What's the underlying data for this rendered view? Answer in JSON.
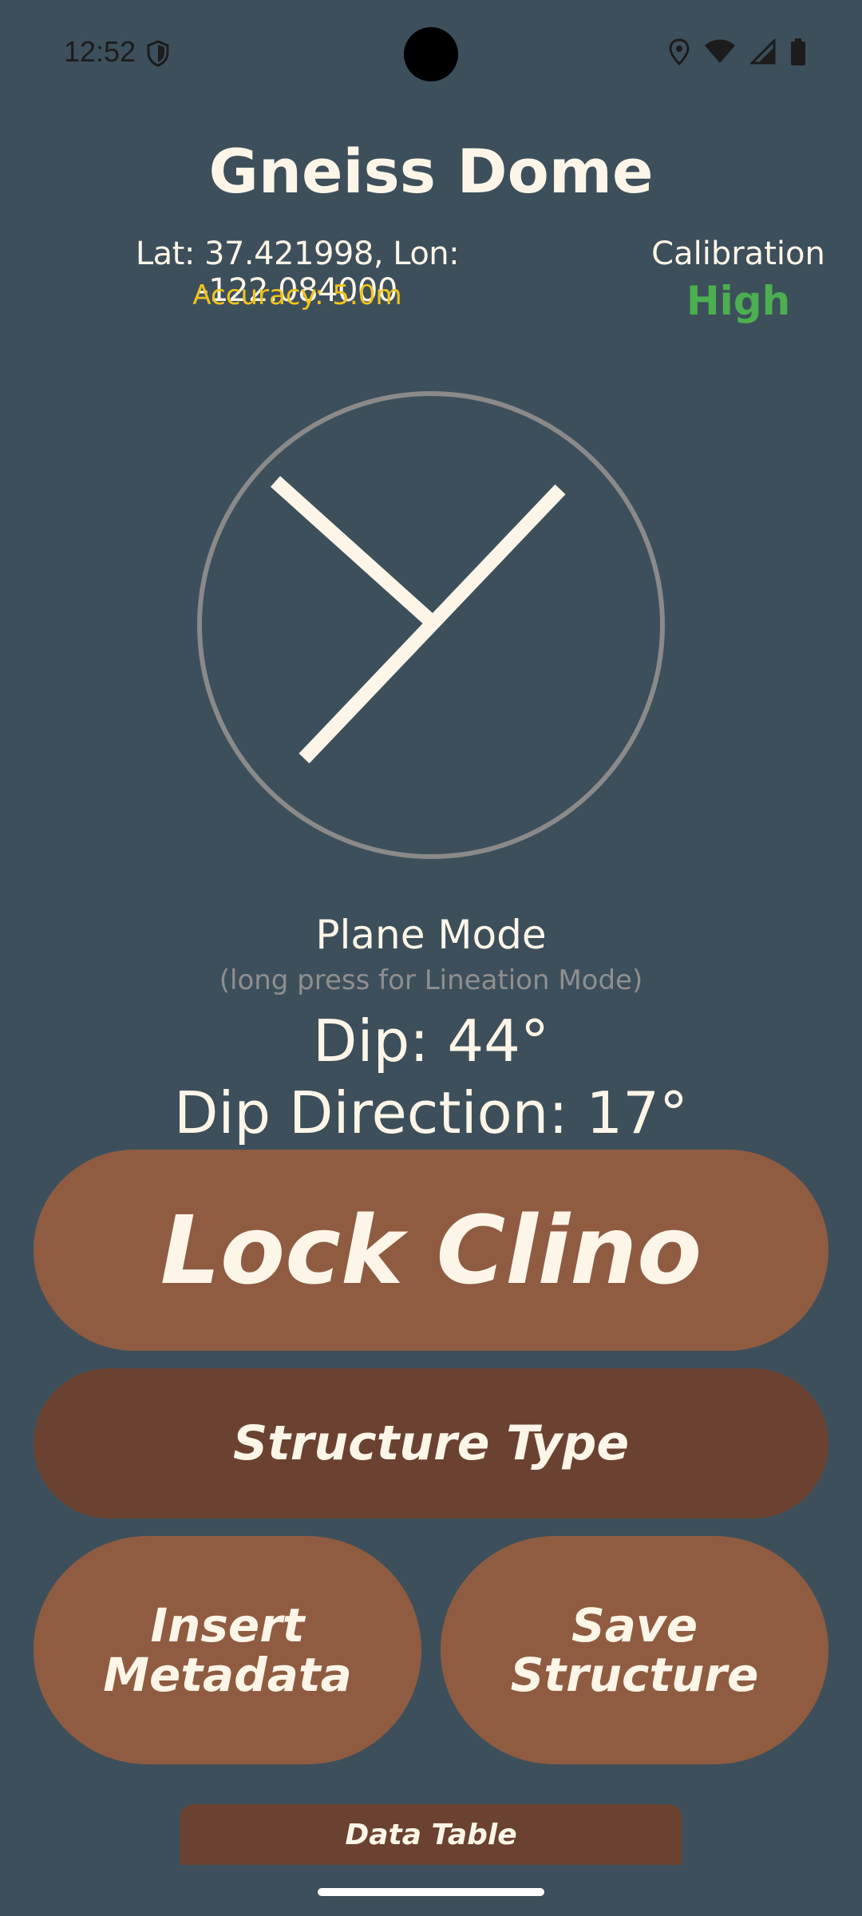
{
  "status_bar": {
    "time": "12:52",
    "icons": [
      "shield-icon",
      "location-icon",
      "wifi-icon",
      "cellular-signal-icon",
      "battery-icon"
    ]
  },
  "header": {
    "title": "Gneiss Dome",
    "coordinates": "Lat: 37.421998, Lon: -122.084000",
    "accuracy": "Accuracy: 5.0m",
    "calibration_label": "Calibration",
    "calibration_value": "High"
  },
  "readout": {
    "mode": "Plane Mode",
    "mode_hint": "(long press for Lineation Mode)",
    "dip": "Dip: 44°",
    "dip_direction": "Dip Direction: 17°"
  },
  "buttons": {
    "lock": "Lock Clino",
    "structure_type": "Structure Type",
    "insert_metadata": "Insert Metadata",
    "save_structure": "Save Structure",
    "data_table": "Data Table"
  },
  "colors": {
    "background": "#3d4f5b",
    "text": "#fdf6e8",
    "accuracy": "#f0c419",
    "calibration_high": "#4caf50",
    "button_primary": "#8f5c42",
    "button_dark": "#6b4231",
    "compass_ring": "#8a8a8a"
  }
}
